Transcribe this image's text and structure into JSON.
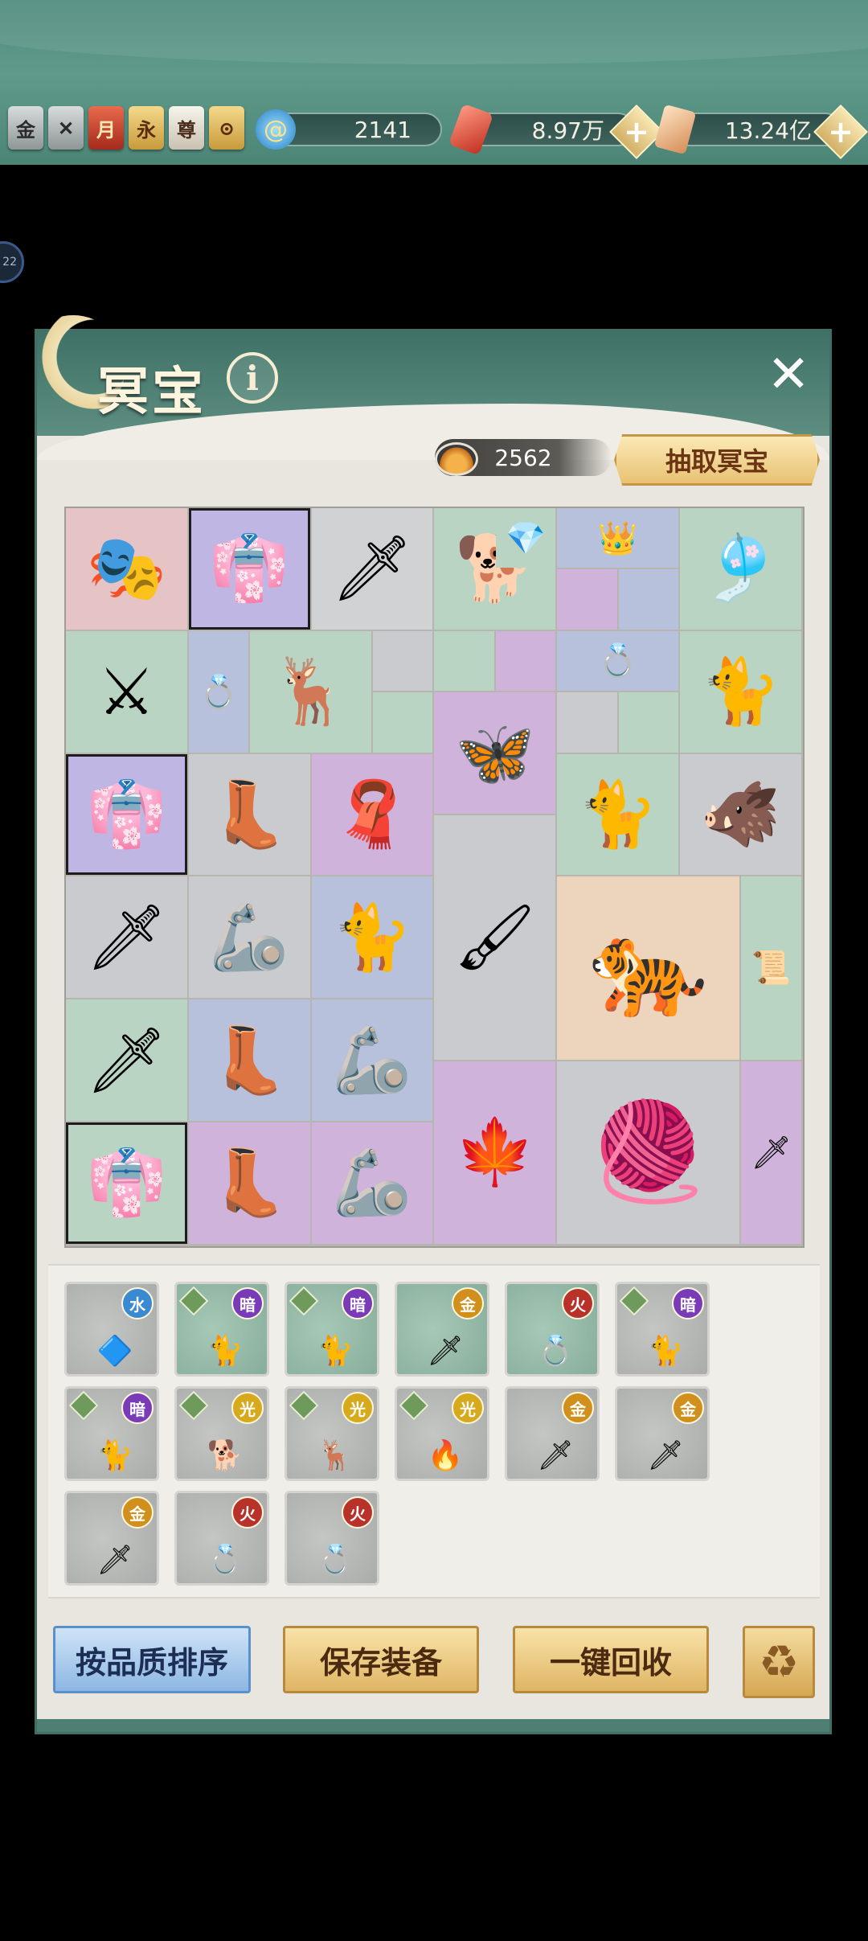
{
  "topbar": {
    "badges": [
      {
        "label": "金",
        "style": "gray"
      },
      {
        "label": "",
        "style": "gray"
      },
      {
        "label": "月",
        "style": "red"
      },
      {
        "label": "永",
        "style": "gold"
      },
      {
        "label": "尊",
        "style": "white"
      },
      {
        "label": "",
        "style": "gold"
      }
    ],
    "resources": [
      {
        "name": "spiral-currency",
        "value": "2141"
      },
      {
        "name": "red-crystal",
        "value": "8.97万"
      },
      {
        "name": "gold-ticket",
        "value": "13.24亿"
      }
    ],
    "plus_label": "+"
  },
  "side_badge": "22",
  "panel": {
    "title": "冥宝",
    "info_label": "i",
    "close_label": "✕",
    "currency_value": "2562",
    "draw_button": "抽取冥宝"
  },
  "grid_items": [
    {
      "id": "mask",
      "glyph": "🎭",
      "bg": "#e6c3c5"
    },
    {
      "id": "robe-1",
      "glyph": "👘",
      "bg": "#bfb6e4"
    },
    {
      "id": "dagger-1",
      "glyph": "🗡",
      "bg": "#d0d2d4"
    },
    {
      "id": "dog",
      "glyph": "🐕",
      "bg": "#b9d4c3"
    },
    {
      "id": "crystal",
      "glyph": "💎",
      "bg": "#b9d4c3"
    },
    {
      "id": "ring-crown",
      "glyph": "👑",
      "bg": "#b7c1dc"
    },
    {
      "id": "tassels",
      "glyph": "🎐",
      "bg": "#b9d4c3"
    },
    {
      "id": "golden-dagger",
      "glyph": "⚔",
      "bg": "#b9d4c3"
    },
    {
      "id": "ring-1",
      "glyph": "💍",
      "bg": "#b7c1dc"
    },
    {
      "id": "deer",
      "glyph": "🦌",
      "bg": "#b9d4c3"
    },
    {
      "id": "ring-2",
      "glyph": "💍",
      "bg": "#b7c1dc"
    },
    {
      "id": "cat-1",
      "glyph": "🐈",
      "bg": "#b9d4c3"
    },
    {
      "id": "robe-2",
      "glyph": "👘",
      "bg": "#bfb6e4"
    },
    {
      "id": "boots-1",
      "glyph": "👢",
      "bg": "#c9cbce"
    },
    {
      "id": "red-cape",
      "glyph": "🧣",
      "bg": "#cfb3db"
    },
    {
      "id": "butterfly",
      "glyph": "🦋",
      "bg": "#cfb3db"
    },
    {
      "id": "white-cat-1",
      "glyph": "🐈",
      "bg": "#b9d4c3"
    },
    {
      "id": "boar",
      "glyph": "🐗",
      "bg": "#c9cbce"
    },
    {
      "id": "dagger-2",
      "glyph": "🗡",
      "bg": "#c9cbce"
    },
    {
      "id": "armor-1",
      "glyph": "🦾",
      "bg": "#c9cbce"
    },
    {
      "id": "white-cat-2",
      "glyph": "🐈",
      "bg": "#b7c1dc"
    },
    {
      "id": "brushes",
      "glyph": "🖌",
      "bg": "#c9cbce"
    },
    {
      "id": "tiger-pelt",
      "glyph": "🐅",
      "bg": "#ecd4bd"
    },
    {
      "id": "scroll-rod",
      "glyph": "📜",
      "bg": "#b9d4c3"
    },
    {
      "id": "dagger-3",
      "glyph": "🗡",
      "bg": "#b9d4c3"
    },
    {
      "id": "boots-2",
      "glyph": "👢",
      "bg": "#b7c1dc"
    },
    {
      "id": "armor-2",
      "glyph": "🦾",
      "bg": "#b7c1dc"
    },
    {
      "id": "maple-staff",
      "glyph": "🍁",
      "bg": "#cfb3db"
    },
    {
      "id": "fur-pelt",
      "glyph": "🧶",
      "bg": "#c9cbce"
    },
    {
      "id": "sword",
      "glyph": "🗡",
      "bg": "#cfb3db"
    },
    {
      "id": "robe-3",
      "glyph": "👘",
      "bg": "#b9d4c3"
    },
    {
      "id": "boots-3",
      "glyph": "👢",
      "bg": "#cfb3db"
    },
    {
      "id": "armor-3",
      "glyph": "🦾",
      "bg": "#cfb3db"
    }
  ],
  "inventory": [
    {
      "element": "水",
      "cls": "water",
      "locked": false,
      "bg": "g",
      "thumb": "🔷"
    },
    {
      "element": "暗",
      "cls": "dark",
      "locked": true,
      "bg": "grn",
      "thumb": "🐈"
    },
    {
      "element": "暗",
      "cls": "dark",
      "locked": true,
      "bg": "grn",
      "thumb": "🐈"
    },
    {
      "element": "金",
      "cls": "gold",
      "locked": false,
      "bg": "grn",
      "thumb": "🗡"
    },
    {
      "element": "火",
      "cls": "fire",
      "locked": false,
      "bg": "grn",
      "thumb": "💍"
    },
    {
      "element": "暗",
      "cls": "dark",
      "locked": true,
      "bg": "g",
      "thumb": "🐈"
    },
    {
      "element": "暗",
      "cls": "dark",
      "locked": true,
      "bg": "g",
      "thumb": "🐈"
    },
    {
      "element": "光",
      "cls": "light",
      "locked": true,
      "bg": "g",
      "thumb": "🐕"
    },
    {
      "element": "光",
      "cls": "light",
      "locked": true,
      "bg": "g",
      "thumb": "🦌"
    },
    {
      "element": "光",
      "cls": "light",
      "locked": true,
      "bg": "g",
      "thumb": "🔥"
    },
    {
      "element": "金",
      "cls": "gold",
      "locked": false,
      "bg": "g",
      "thumb": "🗡"
    },
    {
      "element": "金",
      "cls": "gold",
      "locked": false,
      "bg": "g",
      "thumb": "🗡"
    },
    {
      "element": "金",
      "cls": "gold",
      "locked": false,
      "bg": "g",
      "thumb": "🗡"
    },
    {
      "element": "火",
      "cls": "fire",
      "locked": false,
      "bg": "g",
      "thumb": "💍"
    },
    {
      "element": "火",
      "cls": "fire",
      "locked": false,
      "bg": "g",
      "thumb": "💍"
    }
  ],
  "buttons": {
    "sort": "按品质排序",
    "save": "保存装备",
    "recycle_all": "一键回收",
    "recycle_icon": "♻"
  }
}
